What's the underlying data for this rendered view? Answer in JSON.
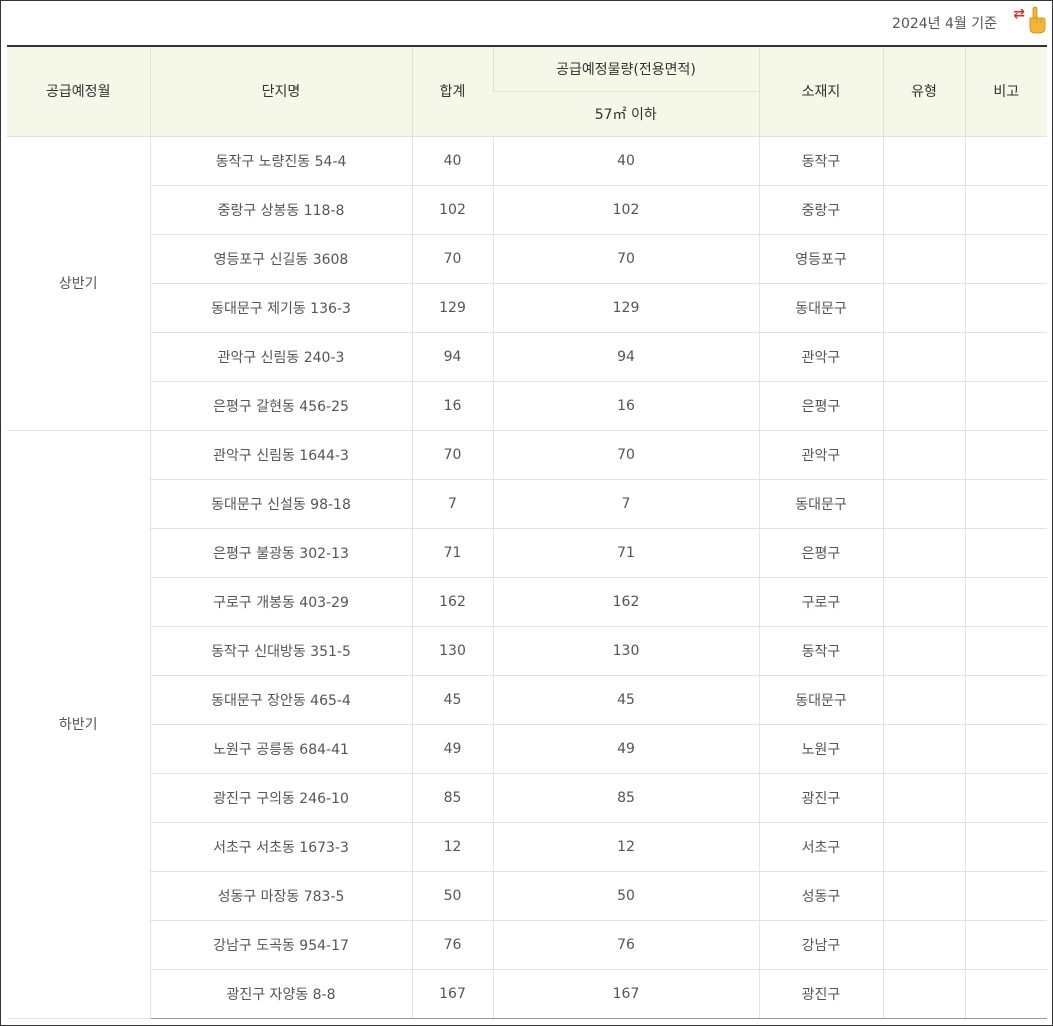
{
  "header": {
    "as_of": "2024년 4월 기준",
    "swap_icon": "⇄",
    "hand_icon": "pointing-hand-icon"
  },
  "columns": {
    "month": "공급예정월",
    "name": "단지명",
    "total": "합계",
    "supply_group": "공급예정물량(전용면적)",
    "supply_sub": "57㎡ 이하",
    "location": "소재지",
    "type": "유형",
    "note": "비고"
  },
  "halves": [
    {
      "label": "상반기",
      "rows": [
        {
          "name": "동작구 노량진동 54-4",
          "total": "40",
          "supply": "40",
          "location": "동작구",
          "type": "",
          "note": ""
        },
        {
          "name": "중랑구 상봉동 118-8",
          "total": "102",
          "supply": "102",
          "location": "중랑구",
          "type": "",
          "note": ""
        },
        {
          "name": "영등포구 신길동 3608",
          "total": "70",
          "supply": "70",
          "location": "영등포구",
          "type": "",
          "note": ""
        },
        {
          "name": "동대문구 제기동 136-3",
          "total": "129",
          "supply": "129",
          "location": "동대문구",
          "type": "",
          "note": ""
        },
        {
          "name": "관악구 신림동 240-3",
          "total": "94",
          "supply": "94",
          "location": "관악구",
          "type": "",
          "note": ""
        },
        {
          "name": "은평구 갈현동 456-25",
          "total": "16",
          "supply": "16",
          "location": "은평구",
          "type": "",
          "note": ""
        }
      ]
    },
    {
      "label": "하반기",
      "rows": [
        {
          "name": "관악구 신림동 1644-3",
          "total": "70",
          "supply": "70",
          "location": "관악구",
          "type": "",
          "note": ""
        },
        {
          "name": "동대문구 신설동 98-18",
          "total": "7",
          "supply": "7",
          "location": "동대문구",
          "type": "",
          "note": ""
        },
        {
          "name": "은평구 불광동 302-13",
          "total": "71",
          "supply": "71",
          "location": "은평구",
          "type": "",
          "note": ""
        },
        {
          "name": "구로구 개봉동 403-29",
          "total": "162",
          "supply": "162",
          "location": "구로구",
          "type": "",
          "note": ""
        },
        {
          "name": "동작구 신대방동 351-5",
          "total": "130",
          "supply": "130",
          "location": "동작구",
          "type": "",
          "note": ""
        },
        {
          "name": "동대문구 장안동 465-4",
          "total": "45",
          "supply": "45",
          "location": "동대문구",
          "type": "",
          "note": ""
        },
        {
          "name": "노원구 공릉동 684-41",
          "total": "49",
          "supply": "49",
          "location": "노원구",
          "type": "",
          "note": ""
        },
        {
          "name": "광진구 구의동 246-10",
          "total": "85",
          "supply": "85",
          "location": "광진구",
          "type": "",
          "note": ""
        },
        {
          "name": "서초구 서초동 1673-3",
          "total": "12",
          "supply": "12",
          "location": "서초구",
          "type": "",
          "note": ""
        },
        {
          "name": "성동구 마장동 783-5",
          "total": "50",
          "supply": "50",
          "location": "성동구",
          "type": "",
          "note": ""
        },
        {
          "name": "강남구 도곡동 954-17",
          "total": "76",
          "supply": "76",
          "location": "강남구",
          "type": "",
          "note": ""
        },
        {
          "name": "광진구 자양동 8-8",
          "total": "167",
          "supply": "167",
          "location": "광진구",
          "type": "",
          "note": ""
        }
      ]
    }
  ]
}
